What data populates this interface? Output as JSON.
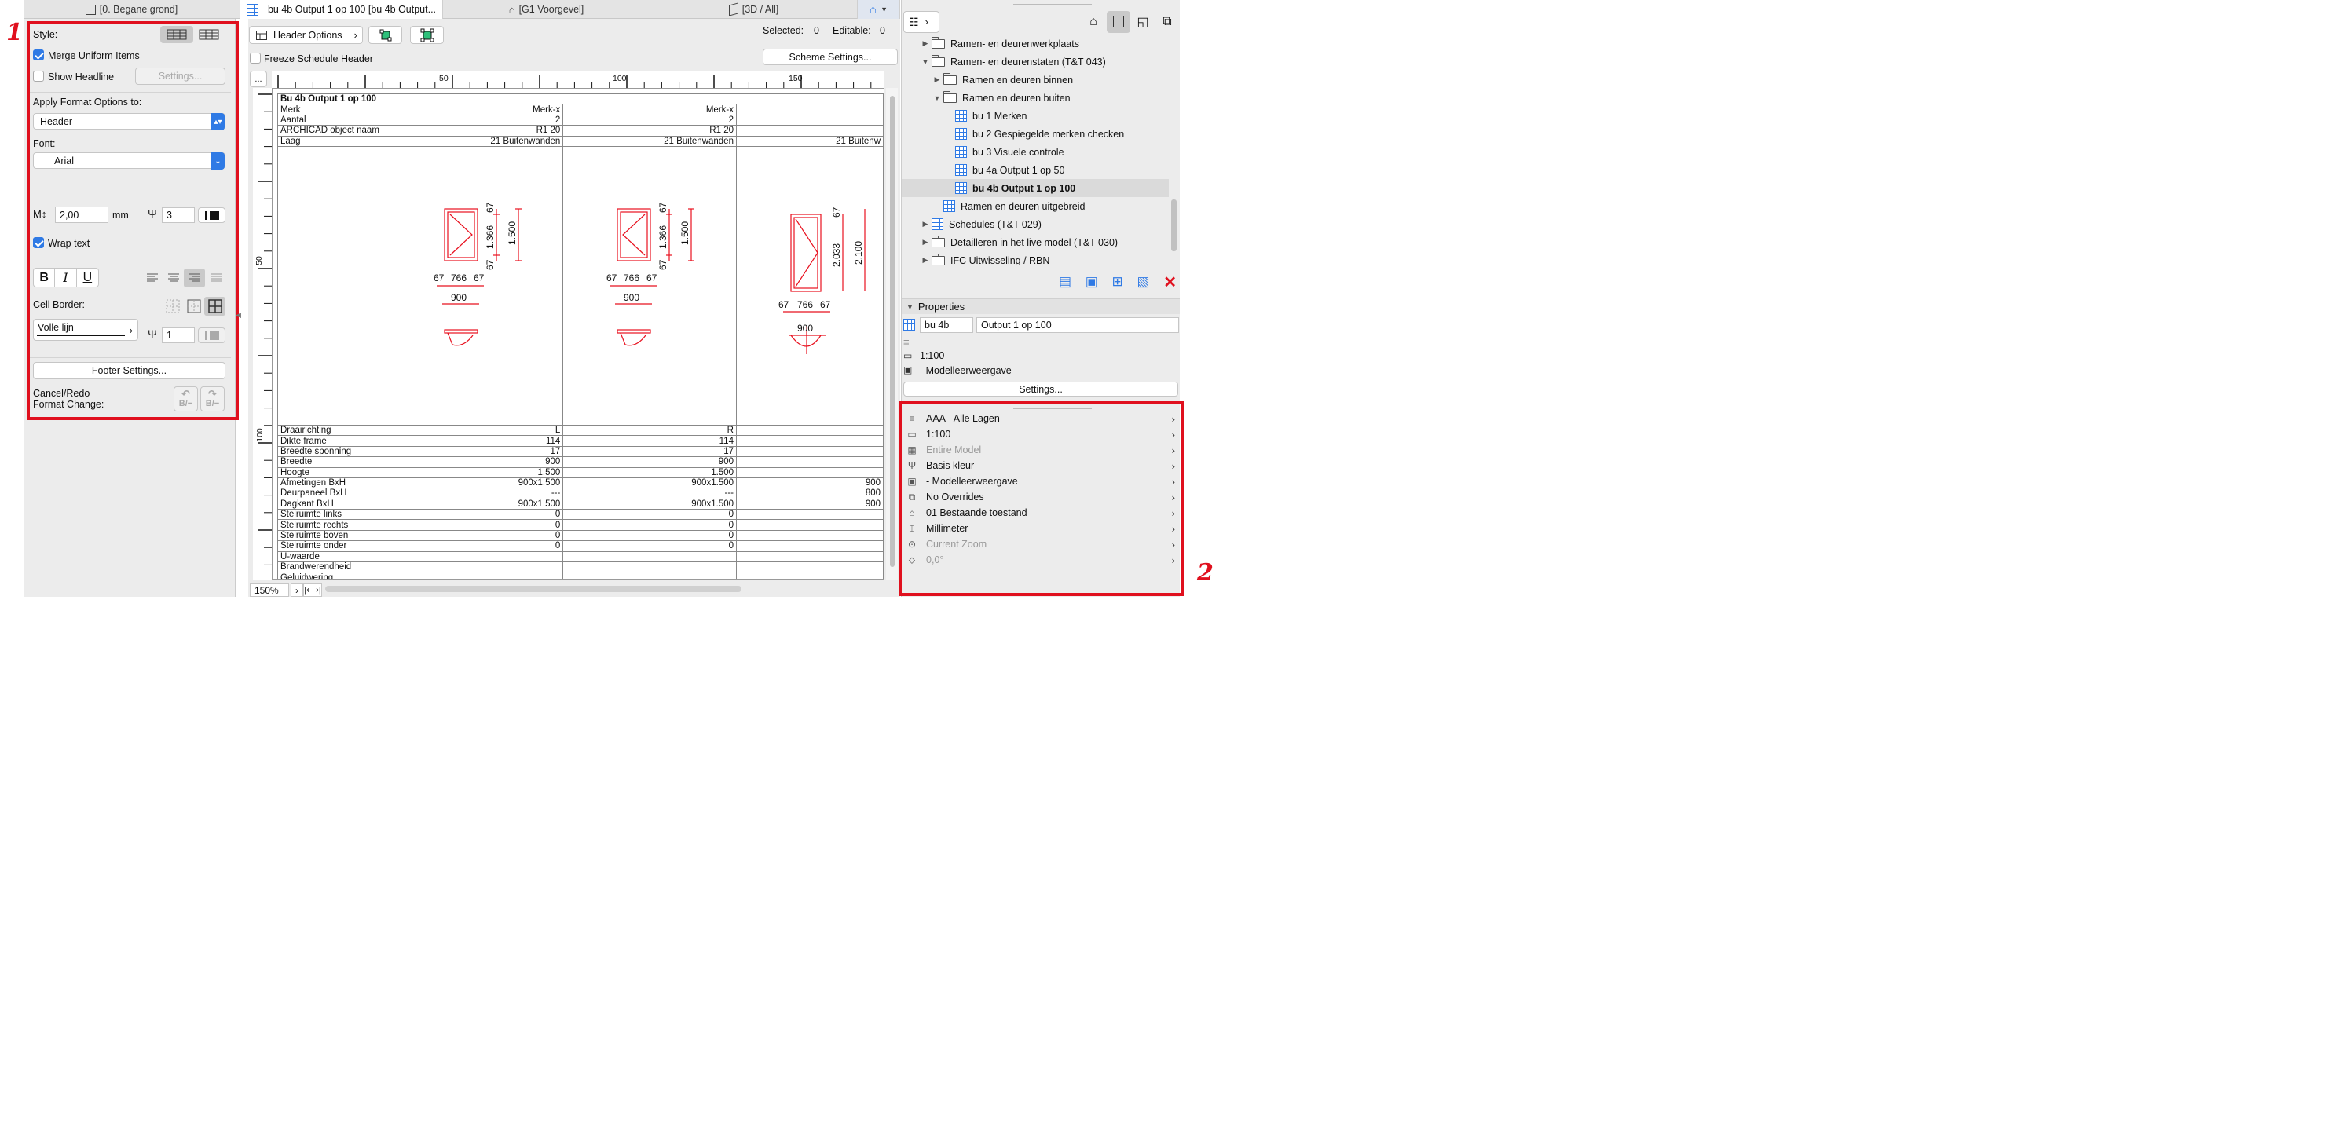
{
  "annotations": {
    "left_number": "1",
    "right_number": "2"
  },
  "tabs": [
    {
      "label": "[0. Begane grond]",
      "icon": "floorplan-icon"
    },
    {
      "label": "bu 4b Output 1 op 100 [bu 4b Output...",
      "icon": "schedule-icon"
    },
    {
      "label": "[G1 Voorgevel]",
      "icon": "elevation-icon"
    },
    {
      "label": "[3D / All]",
      "icon": "3d-icon"
    }
  ],
  "format_panel": {
    "style_label": "Style:",
    "merge_label": "Merge Uniform Items",
    "headline_label": "Show Headline",
    "settings_btn": "Settings...",
    "apply_label": "Apply Format Options to:",
    "apply_value": "Header",
    "font_label": "Font:",
    "font_value": "Arial",
    "size_value": "2,00",
    "size_unit": "mm",
    "pen_value": "3",
    "wrap_label": "Wrap text",
    "bold": "B",
    "italic": "I",
    "underline": "U",
    "cell_border_label": "Cell Border:",
    "line_type": "Volle lijn",
    "border_pen": "1",
    "footer_btn": "Footer Settings...",
    "cancel_redo_label": "Cancel/Redo\nFormat Change:",
    "undo_caption": "B/−",
    "redo_caption": "B/−"
  },
  "toolbar": {
    "header_options": "Header Options",
    "selected_label": "Selected:",
    "selected_value": "0",
    "editable_label": "Editable:",
    "editable_value": "0",
    "freeze_label": "Freeze Schedule Header",
    "scheme_btn": "Scheme Settings...",
    "more_btn": "..."
  },
  "ruler": {
    "h_labels": [
      "50",
      "100",
      "150"
    ],
    "v_labels": [
      "50",
      "100"
    ]
  },
  "schedule": {
    "title": "Bu 4b Output 1 op 100",
    "header_rows": [
      {
        "label": "Merk",
        "values": [
          "Merk-x",
          "Merk-x",
          ""
        ]
      },
      {
        "label": "Aantal",
        "values": [
          "2",
          "2",
          ""
        ]
      },
      {
        "label": "ARCHICAD object naam",
        "values": [
          "R1 20",
          "R1 20",
          ""
        ]
      },
      {
        "label": "Laag",
        "values": [
          "21 Buitenwanden",
          "21 Buitenwanden",
          "21 Buitenw"
        ]
      }
    ],
    "drawings": [
      {
        "h_dim1": "1.366",
        "h_dim2": "1.500",
        "top": "67",
        "bot": "67",
        "w_left": "67",
        "w_mid": "766",
        "w_right": "67",
        "w_total": "900"
      },
      {
        "h_dim1": "1.366",
        "h_dim2": "1.500",
        "top": "67",
        "bot": "67",
        "w_left": "67",
        "w_mid": "766",
        "w_right": "67",
        "w_total": "900"
      },
      {
        "h_dim1": "2.033",
        "h_dim2": "2.100",
        "top": "67",
        "w_left": "67",
        "w_mid": "766",
        "w_right": "67",
        "w_total": "900"
      }
    ],
    "data_rows": [
      {
        "label": "Draairichting",
        "values": [
          "L",
          "R",
          ""
        ]
      },
      {
        "label": "Dikte frame",
        "values": [
          "114",
          "114",
          ""
        ]
      },
      {
        "label": "Breedte sponning",
        "values": [
          "17",
          "17",
          ""
        ]
      },
      {
        "label": "Breedte",
        "values": [
          "900",
          "900",
          ""
        ]
      },
      {
        "label": "Hoogte",
        "values": [
          "1.500",
          "1.500",
          ""
        ]
      },
      {
        "label": "Afmetingen BxH",
        "values": [
          "900x1.500",
          "900x1.500",
          "900"
        ]
      },
      {
        "label": "Deurpaneel BxH",
        "values": [
          "---",
          "---",
          "800"
        ]
      },
      {
        "label": "Dagkant BxH",
        "values": [
          "900x1.500",
          "900x1.500",
          "900"
        ]
      },
      {
        "label": "Stelruimte links",
        "values": [
          "0",
          "0",
          ""
        ]
      },
      {
        "label": "Stelruimte rechts",
        "values": [
          "0",
          "0",
          ""
        ]
      },
      {
        "label": "Stelruimte boven",
        "values": [
          "0",
          "0",
          ""
        ]
      },
      {
        "label": "Stelruimte onder",
        "values": [
          "0",
          "0",
          ""
        ]
      },
      {
        "label": "U-waarde",
        "values": [
          "",
          "",
          ""
        ]
      },
      {
        "label": "Brandwerendheid",
        "values": [
          "",
          "",
          ""
        ]
      },
      {
        "label": "Geluidwering",
        "values": [
          "",
          "",
          ""
        ]
      }
    ]
  },
  "statusbar": {
    "zoom": "150%"
  },
  "navigator": {
    "tree": [
      {
        "label": "Ramen- en deurenwerkplaats",
        "indent": 1,
        "toggle": "▶",
        "icon": "folder"
      },
      {
        "label": "Ramen- en deurenstaten (T&T 043)",
        "indent": 1,
        "toggle": "▼",
        "icon": "folder"
      },
      {
        "label": "Ramen en deuren binnen",
        "indent": 2,
        "toggle": "▶",
        "icon": "folder"
      },
      {
        "label": "Ramen en deuren buiten",
        "indent": 2,
        "toggle": "▼",
        "icon": "folder"
      },
      {
        "label": "bu 1 Merken",
        "indent": 3,
        "toggle": "",
        "icon": "schedule"
      },
      {
        "label": "bu 2 Gespiegelde merken checken",
        "indent": 3,
        "toggle": "",
        "icon": "schedule"
      },
      {
        "label": "bu 3 Visuele controle",
        "indent": 3,
        "toggle": "",
        "icon": "schedule"
      },
      {
        "label": "bu 4a Output 1 op  50",
        "indent": 3,
        "toggle": "",
        "icon": "schedule"
      },
      {
        "label": "bu 4b Output 1 op 100",
        "indent": 3,
        "toggle": "",
        "icon": "schedule",
        "selected": true
      },
      {
        "label": "Ramen en deuren uitgebreid",
        "indent": 2,
        "toggle": "",
        "icon": "schedule"
      },
      {
        "label": "Schedules (T&T 029)",
        "indent": 1,
        "toggle": "▶",
        "icon": "schedule"
      },
      {
        "label": "Detailleren in het live model (T&T 030)",
        "indent": 1,
        "toggle": "▶",
        "icon": "folder"
      },
      {
        "label": "IFC Uitwisseling / RBN",
        "indent": 1,
        "toggle": "▶",
        "icon": "folder"
      }
    ]
  },
  "properties": {
    "header": "Properties",
    "id_value": "bu 4b",
    "name_value": "Output 1 op 100",
    "scale": "1:100",
    "view": "- Modelleerweergave",
    "settings_btn": "Settings..."
  },
  "quick_options": [
    {
      "label": "AAA - Alle Lagen",
      "icon": "layers-icon",
      "disabled": false
    },
    {
      "label": "1:100",
      "icon": "scale-icon",
      "disabled": false
    },
    {
      "label": "Entire Model",
      "icon": "structure-icon",
      "disabled": true
    },
    {
      "label": "Basis kleur",
      "icon": "pen-icon",
      "disabled": false
    },
    {
      "label": "- Modelleerweergave",
      "icon": "model-view-icon",
      "disabled": false
    },
    {
      "label": "No Overrides",
      "icon": "overrides-icon",
      "disabled": false
    },
    {
      "label": "01 Bestaande toestand",
      "icon": "renovation-icon",
      "disabled": false
    },
    {
      "label": "Millimeter",
      "icon": "dimension-icon",
      "disabled": false
    },
    {
      "label": "Current Zoom",
      "icon": "zoom-icon",
      "disabled": true
    },
    {
      "label": "0,0°",
      "icon": "rotation-icon",
      "disabled": true
    }
  ]
}
